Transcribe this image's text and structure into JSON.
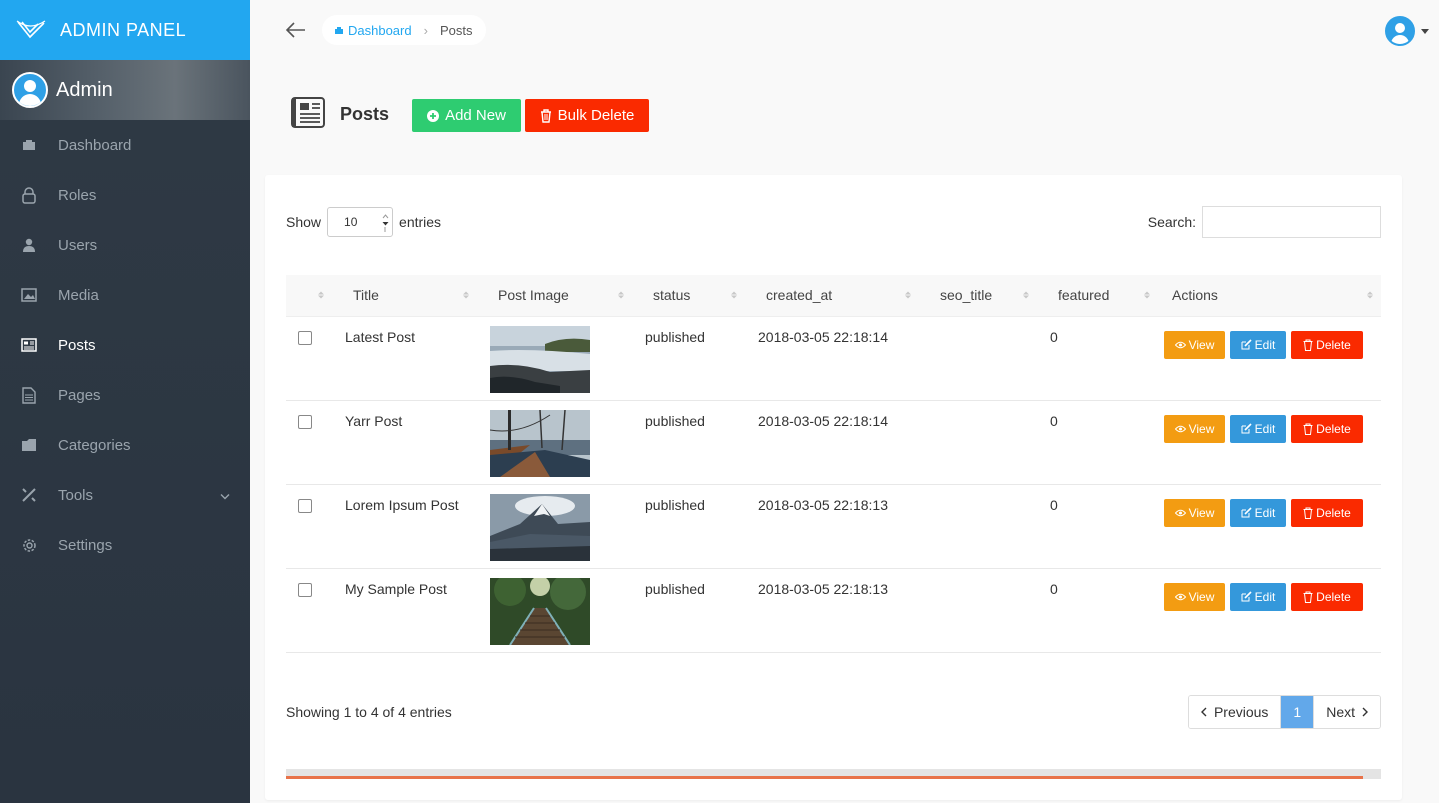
{
  "brand": {
    "title": "ADMIN PANEL",
    "color": "#22a7f0"
  },
  "profile": {
    "name": "Admin"
  },
  "sidebar": {
    "items": [
      {
        "label": "Dashboard",
        "icon": "dashboard-icon"
      },
      {
        "label": "Roles",
        "icon": "lock-icon"
      },
      {
        "label": "Users",
        "icon": "person-icon"
      },
      {
        "label": "Media",
        "icon": "image-icon"
      },
      {
        "label": "Posts",
        "icon": "news-icon",
        "active": true
      },
      {
        "label": "Pages",
        "icon": "file-icon"
      },
      {
        "label": "Categories",
        "icon": "folder-icon"
      },
      {
        "label": "Tools",
        "icon": "tools-icon",
        "has_submenu": true
      },
      {
        "label": "Settings",
        "icon": "gear-icon"
      }
    ]
  },
  "breadcrumb": {
    "home": "Dashboard",
    "current": "Posts"
  },
  "page": {
    "title": "Posts",
    "add_label": "Add New",
    "bulk_delete_label": "Bulk Delete"
  },
  "table_controls": {
    "show_label": "Show",
    "entries_label": "entries",
    "length_value": "10",
    "search_label": "Search:"
  },
  "table": {
    "columns": [
      "",
      "Title",
      "Post Image",
      "status",
      "created_at",
      "seo_title",
      "featured",
      "Actions"
    ],
    "rows": [
      {
        "title": "Latest Post",
        "image": "sea-cliff-photo",
        "status": "published",
        "created_at": "2018-03-05 22:18:14",
        "seo_title": "",
        "featured": "0"
      },
      {
        "title": "Yarr Post",
        "image": "ship-deck-photo",
        "status": "published",
        "created_at": "2018-03-05 22:18:14",
        "seo_title": "",
        "featured": "0"
      },
      {
        "title": "Lorem Ipsum Post",
        "image": "mountain-photo",
        "status": "published",
        "created_at": "2018-03-05 22:18:13",
        "seo_title": "",
        "featured": "0"
      },
      {
        "title": "My Sample Post",
        "image": "forest-bridge-photo",
        "status": "published",
        "created_at": "2018-03-05 22:18:13",
        "seo_title": "",
        "featured": "0"
      }
    ],
    "actions": {
      "view": "View",
      "edit": "Edit",
      "delete": "Delete"
    }
  },
  "footer": {
    "info": "Showing 1 to 4 of 4 entries",
    "prev": "Previous",
    "page": "1",
    "next": "Next"
  },
  "colors": {
    "add": "#2ecc71",
    "delete": "#fa2a00",
    "view": "#f39c12",
    "edit": "#3498db",
    "active_page": "#62a8ea"
  }
}
